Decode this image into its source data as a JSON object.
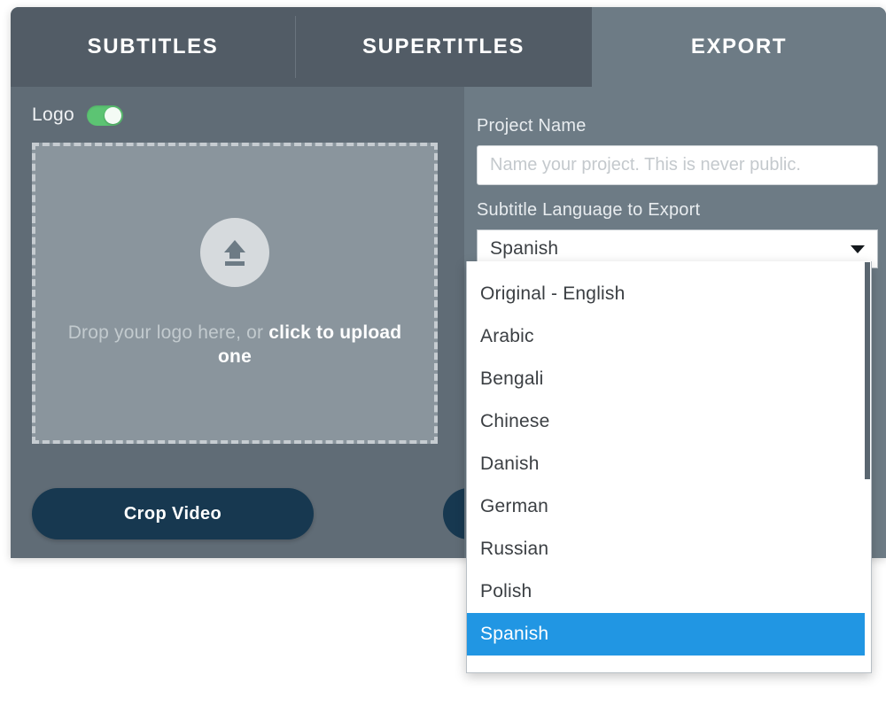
{
  "tabs": [
    {
      "label": "SUBTITLES",
      "active": false
    },
    {
      "label": "SUPERTITLES",
      "active": false
    },
    {
      "label": "EXPORT",
      "active": true
    }
  ],
  "left_pane": {
    "logo_label": "Logo",
    "logo_toggle_state": "on",
    "dropzone": {
      "text_normal": "Drop your logo here, or ",
      "text_bold": "click to upload one",
      "icon": "upload-icon"
    },
    "crop_button_label": "Crop Video",
    "secondary_button_label": ""
  },
  "right_pane": {
    "project_name_label": "Project Name",
    "project_name_value": "",
    "project_name_placeholder": "Name your project. This is never public.",
    "subtitle_language_label": "Subtitle Language to Export",
    "selected_language": "Spanish",
    "language_options": [
      "Original - English",
      "Arabic",
      "Bengali",
      "Chinese",
      "Danish",
      "German",
      "Russian",
      "Polish",
      "Spanish"
    ]
  },
  "colors": {
    "panel_bg": "#6d7b85",
    "left_pane_bg": "#606c76",
    "tab_inactive": "#525c66",
    "accent_blue": "#2196e3",
    "toggle_green": "#5cc473",
    "button_dark": "#173850"
  }
}
